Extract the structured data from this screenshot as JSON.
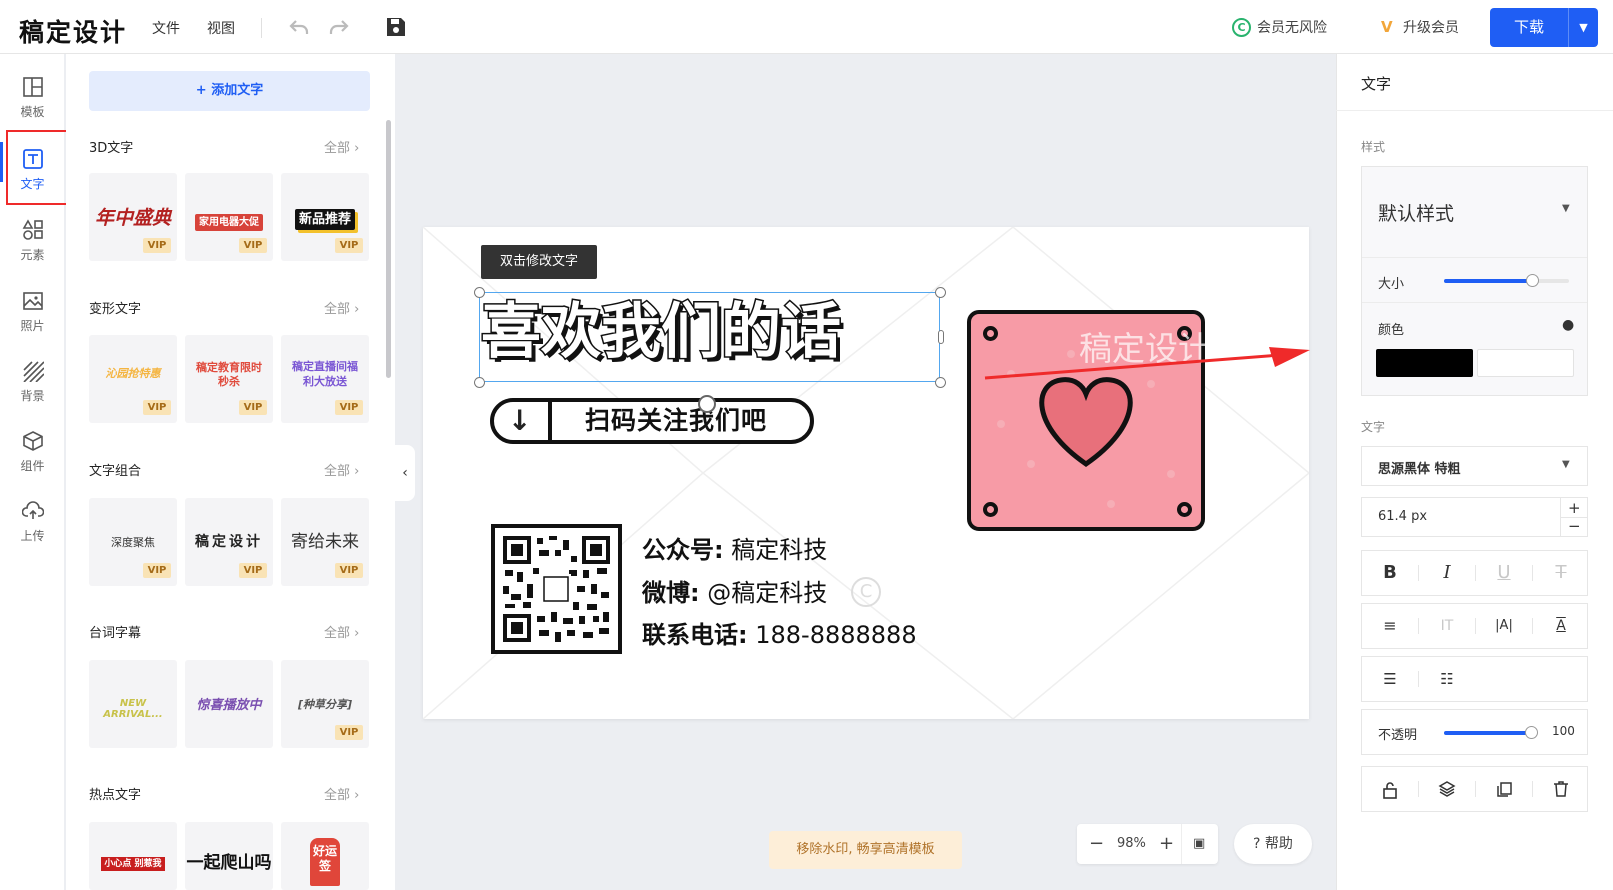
{
  "header": {
    "logo": "稿定设计",
    "menus": [
      "文件",
      "视图"
    ],
    "risk_free": "会员无风险",
    "upgrade": "升级会员",
    "download": "下载"
  },
  "nav": [
    {
      "label": "模板",
      "icon": "template-icon"
    },
    {
      "label": "文字",
      "icon": "text-icon",
      "active": true
    },
    {
      "label": "元素",
      "icon": "elements-icon"
    },
    {
      "label": "照片",
      "icon": "photo-icon"
    },
    {
      "label": "背景",
      "icon": "background-icon"
    },
    {
      "label": "组件",
      "icon": "component-icon"
    },
    {
      "label": "上传",
      "icon": "upload-icon"
    }
  ],
  "panel": {
    "add_text": "+ 添加文字",
    "all_label": "全部",
    "vip": "VIP",
    "sections": [
      {
        "title": "3D文字",
        "items": [
          {
            "text": "年中盛典",
            "color": "#b32121",
            "vip": true
          },
          {
            "text": "家用电器大促",
            "color": "#d7433a",
            "vip": true
          },
          {
            "text": "新品推荐",
            "color": "#111111",
            "vip": true
          }
        ]
      },
      {
        "title": "变形文字",
        "items": [
          {
            "text": "沁园抢特惠",
            "color": "#f4b542",
            "vip": true
          },
          {
            "text": "稿定教育限时秒杀",
            "color": "#e04a3c",
            "vip": true
          },
          {
            "text": "稿定直播间福利大放送",
            "color": "#7a56d4",
            "vip": true
          }
        ]
      },
      {
        "title": "文字组合",
        "items": [
          {
            "text": "深度聚焦",
            "color": "#333333",
            "vip": true
          },
          {
            "text": "稿定设计",
            "color": "#222222",
            "vip": true
          },
          {
            "text": "寄给未来",
            "color": "#333333",
            "vip": true
          }
        ]
      },
      {
        "title": "台词字幕",
        "items": [
          {
            "text": "NEW ARRIVAL...",
            "color": "#c8c24a",
            "vip": false
          },
          {
            "text": "惊喜播放中",
            "color": "#7a4fb0",
            "vip": false
          },
          {
            "text": "[种草分享]",
            "color": "#555555",
            "vip": true
          }
        ]
      },
      {
        "title": "热点文字",
        "items": [
          {
            "text": "小心点 别惹我",
            "color": "#c81e1e",
            "vip": true
          },
          {
            "text": "一起爬山吗",
            "color": "#111111",
            "vip": false
          },
          {
            "text": "好运签",
            "color": "#e0463a",
            "vip": true
          }
        ]
      }
    ]
  },
  "canvas": {
    "tooltip": "双击修改文字",
    "headline": "喜欢我们的话",
    "scan": "扫码关注我们吧",
    "info": [
      {
        "key": "公众号:",
        "value": " 稿定科技"
      },
      {
        "key": "微博:",
        "value": " @稿定科技"
      },
      {
        "key": "联系电话:",
        "value": " 188-8888888"
      }
    ],
    "qr_caption": "稿定设计",
    "watermark": "稿定设计"
  },
  "bottom": {
    "remove_watermark": "移除水印, 畅享高清模板",
    "zoom": "98%",
    "help": "? 帮助"
  },
  "props": {
    "title": "文字",
    "style_label": "样式",
    "style_value": "默认样式",
    "size_label": "大小",
    "size_level": 0.7,
    "color_label": "颜色",
    "color_value": "#000000",
    "text_label": "文字",
    "font": "思源黑体 特粗",
    "font_size": "61.4 px",
    "opacity_label": "不透明",
    "opacity": "100"
  }
}
